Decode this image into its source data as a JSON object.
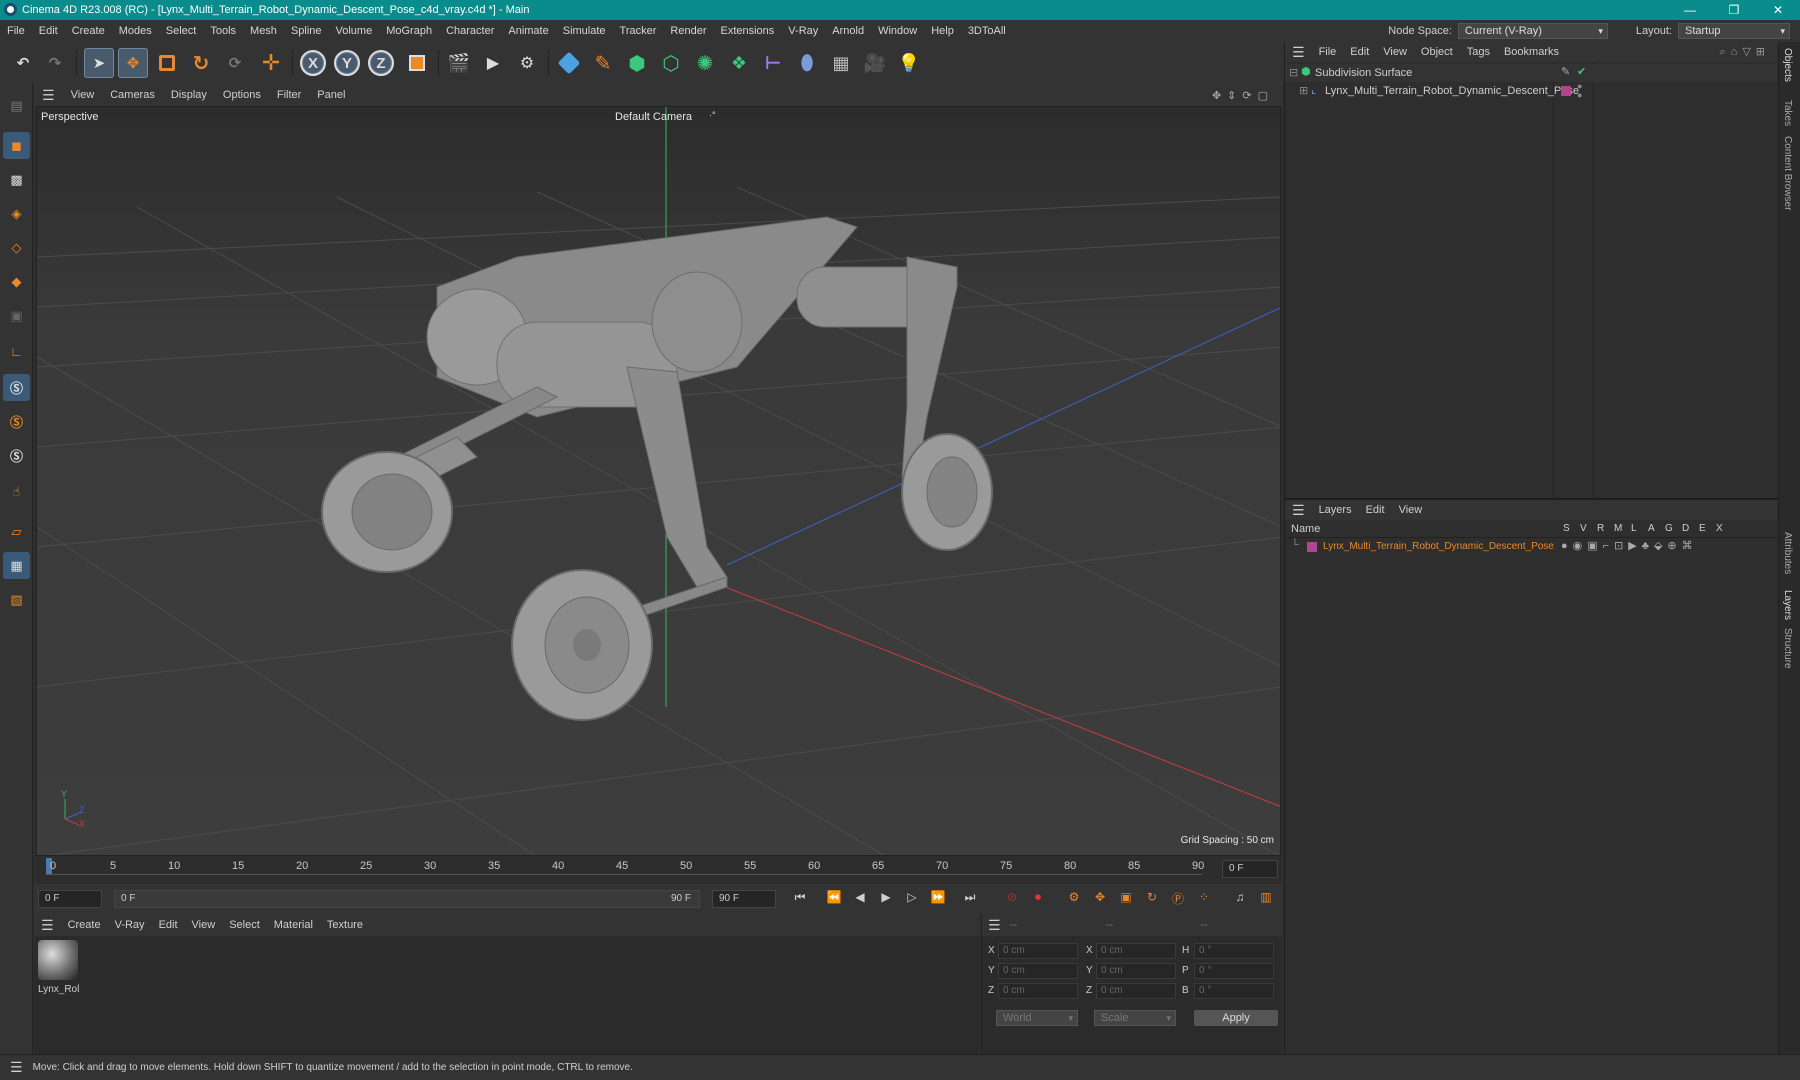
{
  "window": {
    "title": "Cinema 4D R23.008 (RC) - [Lynx_Multi_Terrain_Robot_Dynamic_Descent_Pose_c4d_vray.c4d *] - Main",
    "controls": [
      "—",
      "❐",
      "✕"
    ]
  },
  "menubar": {
    "items": [
      "File",
      "Edit",
      "Create",
      "Modes",
      "Select",
      "Tools",
      "Mesh",
      "Spline",
      "Volume",
      "MoGraph",
      "Character",
      "Animate",
      "Simulate",
      "Tracker",
      "Render",
      "Extensions",
      "V-Ray",
      "Arnold",
      "Window",
      "Help",
      "3DToAll"
    ],
    "node_space_label": "Node Space:",
    "node_space_value": "Current (V-Ray)",
    "layout_label": "Layout:",
    "layout_value": "Startup"
  },
  "toolbar": {
    "axis_x": "X",
    "axis_y": "Y",
    "axis_z": "Z"
  },
  "viewport": {
    "menu": [
      "View",
      "Cameras",
      "Display",
      "Options",
      "Filter",
      "Panel"
    ],
    "view_name": "Perspective",
    "camera": "Default Camera",
    "camera_mark": "·°",
    "grid_spacing": "Grid Spacing : 50 cm",
    "axis_y": "Y",
    "axis_z": "Z",
    "axis_x": "X"
  },
  "timeline": {
    "ticks": [
      "0",
      "5",
      "10",
      "15",
      "20",
      "25",
      "30",
      "35",
      "40",
      "45",
      "50",
      "55",
      "60",
      "65",
      "70",
      "75",
      "80",
      "85",
      "90"
    ],
    "current_frame": "0 F"
  },
  "transport": {
    "start_field": "0 F",
    "range_start": "0 F",
    "range_end": "90 F",
    "end_field": "90 F"
  },
  "material_manager": {
    "menu": [
      "Create",
      "V-Ray",
      "Edit",
      "View",
      "Select",
      "Material",
      "Texture"
    ],
    "material_name": "Lynx_Rol"
  },
  "coordinates": {
    "headers": [
      "--",
      "--",
      "--"
    ],
    "rows": [
      {
        "l1": "X",
        "v1": "0 cm",
        "l2": "X",
        "v2": "0 cm",
        "l3": "H",
        "v3": "0 °"
      },
      {
        "l1": "Y",
        "v1": "0 cm",
        "l2": "Y",
        "v2": "0 cm",
        "l3": "P",
        "v3": "0 °"
      },
      {
        "l1": "Z",
        "v1": "0 cm",
        "l2": "Z",
        "v2": "0 cm",
        "l3": "B",
        "v3": "0 °"
      }
    ],
    "mode": "World",
    "transform": "Scale",
    "apply": "Apply"
  },
  "object_manager": {
    "menu": [
      "File",
      "Edit",
      "View",
      "Object",
      "Tags",
      "Bookmarks"
    ],
    "objects": [
      {
        "name": "Subdivision Surface"
      },
      {
        "name": "Lynx_Multi_Terrain_Robot_Dynamic_Descent_Pose"
      }
    ]
  },
  "layer_manager": {
    "menu": [
      "Layers",
      "Edit",
      "View"
    ],
    "name_header": "Name",
    "flags": [
      "S",
      "V",
      "R",
      "M",
      "L",
      "A",
      "G",
      "D",
      "E",
      "X"
    ],
    "layer_name": "Lynx_Multi_Terrain_Robot_Dynamic_Descent_Pose",
    "layer_color": "#b0458c"
  },
  "side_tabs": [
    "Objects",
    "Takes",
    "Content Browser",
    "Attributes",
    "Layers",
    "Structure"
  ],
  "status": {
    "text": "Move: Click and drag to move elements. Hold down SHIFT to quantize movement / add to the selection in point mode, CTRL to remove."
  },
  "colors": {
    "titlebar": "#0a8c8c",
    "accent_orange": "#e8892a",
    "x_axis": "#c83c3c",
    "y_axis": "#3cb45a",
    "z_axis": "#3c64c8"
  }
}
